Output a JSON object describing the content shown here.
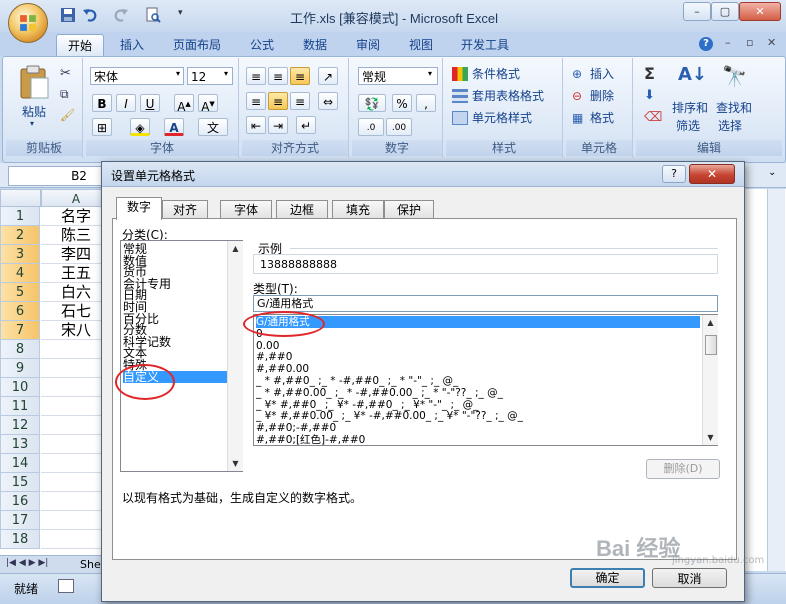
{
  "window": {
    "title": "工作.xls  [兼容模式] - Microsoft Excel",
    "controls": [
      "–",
      "▢",
      "✕"
    ]
  },
  "ribbon_tabs": [
    "开始",
    "插入",
    "页面布局",
    "公式",
    "数据",
    "审阅",
    "视图",
    "开发工具"
  ],
  "ribbon": {
    "clipboard": {
      "paste": "粘贴",
      "label": "剪贴板"
    },
    "font": {
      "name": "宋体",
      "size": "12",
      "label": "字体"
    },
    "alignment": {
      "label": "对齐方式"
    },
    "number": {
      "format": "常规",
      "label": "数字",
      "percent": "%",
      "comma": ","
    },
    "styles": {
      "conditional": "条件格式",
      "table": "套用表格格式",
      "cell": "单元格样式",
      "label": "样式"
    },
    "cells": {
      "insert": "插入",
      "delete": "删除",
      "format": "格式",
      "label": "单元格"
    },
    "editing": {
      "sort": "排序和",
      "sort2": "筛选",
      "find": "查找和",
      "find2": "选择",
      "label": "编辑"
    }
  },
  "namebox": "B2",
  "sheet": {
    "column_a": "A",
    "rows": [
      "1",
      "2",
      "3",
      "4",
      "5",
      "6",
      "7",
      "8",
      "9",
      "10",
      "11",
      "12",
      "13",
      "14",
      "15",
      "16",
      "17",
      "18"
    ],
    "names": [
      "名字",
      "陈三",
      "李四",
      "王五",
      "白六",
      "石七",
      "宋八"
    ],
    "sheet_tab": "She",
    "status": "就绪"
  },
  "dialog": {
    "title": "设置单元格格式",
    "tabs": [
      "数字",
      "对齐",
      "字体",
      "边框",
      "填充",
      "保护"
    ],
    "category_label": "分类(C):",
    "categories": [
      "常规",
      "数值",
      "货币",
      "会计专用",
      "日期",
      "时间",
      "百分比",
      "分数",
      "科学记数",
      "文本",
      "特殊",
      "自定义"
    ],
    "selected_category": "自定义",
    "sample_label": "示例",
    "sample_value": "13888888888",
    "type_label": "类型(T):",
    "type_value": "G/通用格式",
    "types": [
      "G/通用格式",
      "0",
      "0.00",
      "#,##0",
      "#,##0.00",
      "_ * #,##0_ ;_ * -#,##0_ ;_ * \"-\"_ ;_ @_",
      "_ * #,##0.00_ ;_ * -#,##0.00_ ;_ * \"-\"??_ ;_ @_",
      "_ ¥* #,##0_ ;_ ¥* -#,##0_ ;_ ¥* \"-\"_ ;_ @_",
      "_ ¥* #,##0.00_ ;_ ¥* -#,##0.00_ ;_ ¥* \"-\"??_ ;_ @_",
      "#,##0;-#,##0",
      "#,##0;[红色]-#,##0"
    ],
    "delete_label": "删除(D)",
    "description": "以现有格式为基础，生成自定义的数字格式。",
    "ok_label": "确定",
    "cancel_label": "取消"
  },
  "watermark": {
    "text": "Bai 经验",
    "sub": "jingyan.baidu.com"
  },
  "colors": {
    "selection": "#3399ff",
    "annotation_ring": "#e0262a",
    "ribbon_text": "#15428b"
  }
}
